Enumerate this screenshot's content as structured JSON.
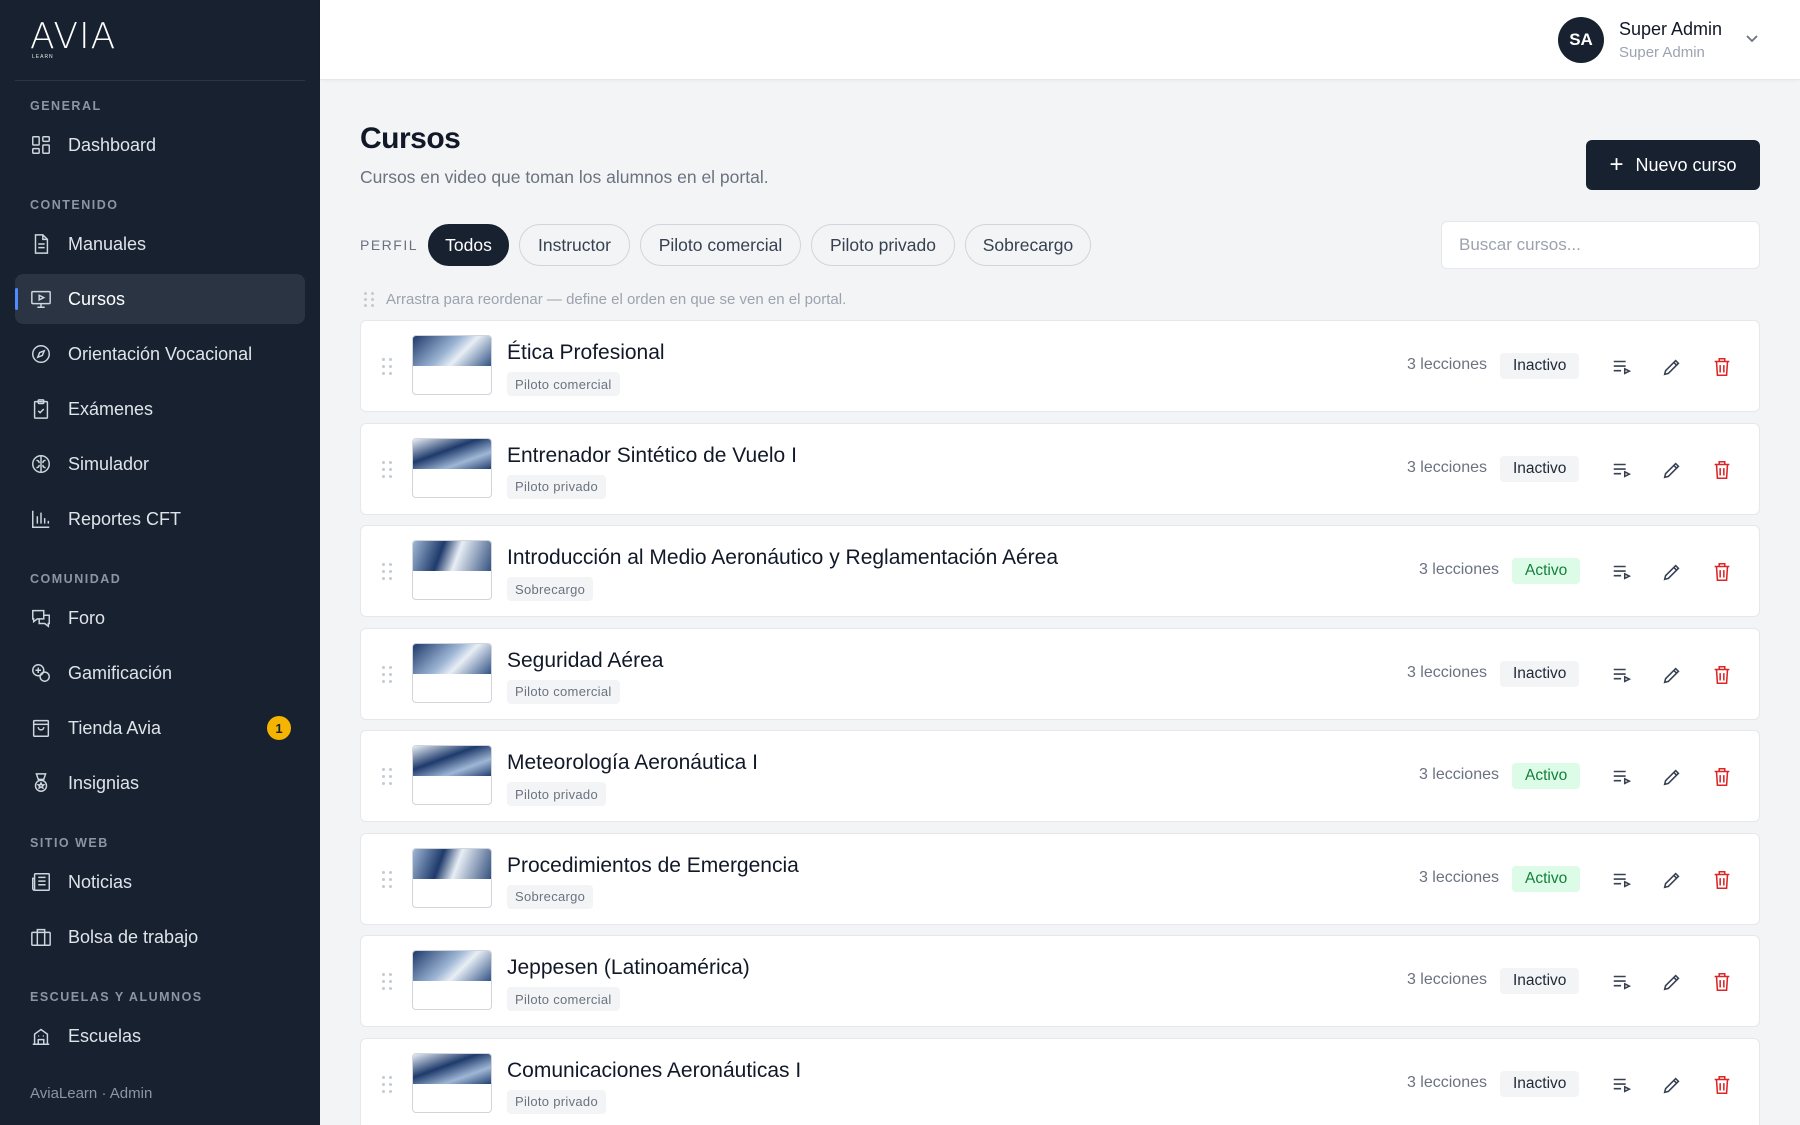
{
  "brand": {
    "logo_text": "AVIA",
    "logo_sub": "LEARN"
  },
  "sidebar": {
    "sections": [
      {
        "label": "GENERAL"
      },
      {
        "label": "CONTENIDO"
      },
      {
        "label": "COMUNIDAD"
      },
      {
        "label": "SITIO WEB"
      },
      {
        "label": "ESCUELAS Y ALUMNOS"
      }
    ],
    "items": [
      {
        "label": "Dashboard",
        "icon": "dashboard-icon"
      },
      {
        "label": "Manuales",
        "icon": "document-icon"
      },
      {
        "label": "Cursos",
        "icon": "video-screen-icon",
        "active": true
      },
      {
        "label": "Orientación Vocacional",
        "icon": "compass-icon"
      },
      {
        "label": "Exámenes",
        "icon": "clipboard-check-icon"
      },
      {
        "label": "Simulador",
        "icon": "brain-icon"
      },
      {
        "label": "Reportes CFT",
        "icon": "bar-chart-icon"
      },
      {
        "label": "Foro",
        "icon": "chat-bubbles-icon"
      },
      {
        "label": "Gamificación",
        "icon": "gamification-icon"
      },
      {
        "label": "Tienda Avia",
        "icon": "shopping-bag-icon",
        "badge": "1"
      },
      {
        "label": "Insignias",
        "icon": "medal-icon"
      },
      {
        "label": "Noticias",
        "icon": "newspaper-icon"
      },
      {
        "label": "Bolsa de trabajo",
        "icon": "briefcase-icon"
      },
      {
        "label": "Escuelas",
        "icon": "school-building-icon"
      }
    ],
    "footer": "AviaLearn · Admin"
  },
  "user": {
    "initials": "SA",
    "name": "Super Admin",
    "role": "Super Admin"
  },
  "page": {
    "title": "Cursos",
    "subtitle": "Cursos en video que toman los alumnos en el portal.",
    "new_button": "Nuevo curso"
  },
  "filters": {
    "label": "PERFIL",
    "chips": [
      "Todos",
      "Instructor",
      "Piloto comercial",
      "Piloto privado",
      "Sobrecargo"
    ],
    "active": "Todos",
    "search_placeholder": "Buscar cursos..."
  },
  "hint": "Arrastra para reordenar — define el orden en que se ven en el portal.",
  "courses": [
    {
      "title": "Ética Profesional",
      "tag": "Piloto comercial",
      "lessons": "3 lecciones",
      "status": "Inactivo"
    },
    {
      "title": "Entrenador Sintético de Vuelo I",
      "tag": "Piloto privado",
      "lessons": "3 lecciones",
      "status": "Inactivo"
    },
    {
      "title": "Introducción al Medio Aeronáutico y Reglamentación Aérea",
      "tag": "Sobrecargo",
      "lessons": "3 lecciones",
      "status": "Activo"
    },
    {
      "title": "Seguridad Aérea",
      "tag": "Piloto comercial",
      "lessons": "3 lecciones",
      "status": "Inactivo"
    },
    {
      "title": "Meteorología Aeronáutica I",
      "tag": "Piloto privado",
      "lessons": "3 lecciones",
      "status": "Activo"
    },
    {
      "title": "Procedimientos de Emergencia",
      "tag": "Sobrecargo",
      "lessons": "3 lecciones",
      "status": "Activo"
    },
    {
      "title": "Jeppesen (Latinoamérica)",
      "tag": "Piloto comercial",
      "lessons": "3 lecciones",
      "status": "Inactivo"
    },
    {
      "title": "Comunicaciones Aeronáuticas I",
      "tag": "Piloto privado",
      "lessons": "3 lecciones",
      "status": "Inactivo"
    }
  ],
  "colors": {
    "sidebar_bg": "#172130",
    "accent": "#4f8cff",
    "active_green": "#15803d",
    "danger": "#dc2626",
    "badge": "#f5b400"
  }
}
